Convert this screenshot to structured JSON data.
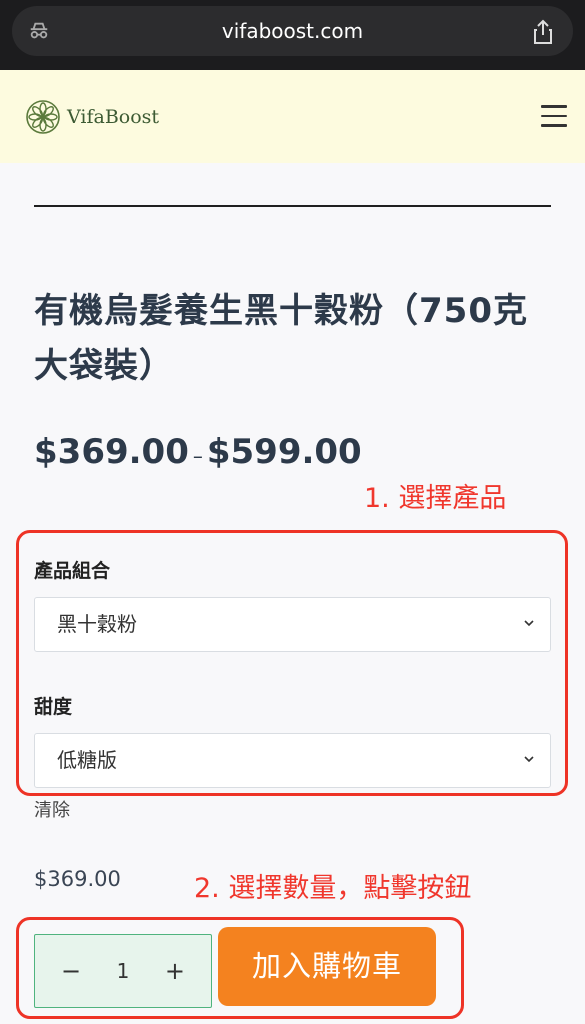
{
  "browser": {
    "url": "vifaboost.com"
  },
  "header": {
    "logo_text": "VifaBoost"
  },
  "product": {
    "title": "有機烏髮養生黑十穀粉（750克大袋裝）",
    "price_min": "$369.00",
    "price_sep": "–",
    "price_max": "$599.00"
  },
  "annotations": {
    "step1": "1. 選擇產品",
    "step2": "2. 選擇數量，點擊按鈕"
  },
  "options": {
    "combo_label": "產品組合",
    "combo_value": "黑十穀粉",
    "sweet_label": "甜度",
    "sweet_value": "低糖版",
    "clear": "清除"
  },
  "variation_price": "$369.00",
  "quantity": {
    "minus": "−",
    "value": "1",
    "plus": "+"
  },
  "add_to_cart": "加入購物車",
  "colors": {
    "accent": "#f4821f",
    "annotation": "#ee3326",
    "header_bg": "#fdfbdf"
  }
}
